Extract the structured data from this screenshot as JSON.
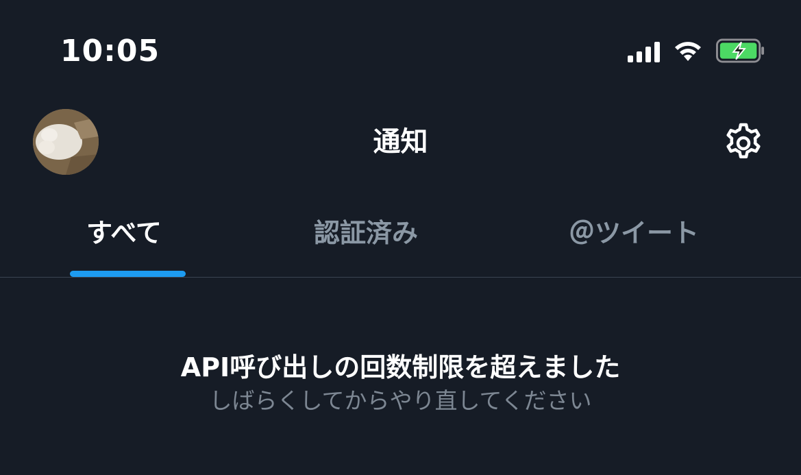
{
  "status_bar": {
    "time": "10:05",
    "icons": [
      "signal-icon",
      "wifi-icon",
      "battery-charging-icon"
    ]
  },
  "header": {
    "title": "通知",
    "avatar": "avatar",
    "settings_icon": "gear-icon"
  },
  "tabs": [
    {
      "label": "すべて",
      "active": true
    },
    {
      "label": "認証済み",
      "active": false
    },
    {
      "label": "＠ツイート",
      "active": false
    }
  ],
  "message": {
    "title": "API呼び出しの回数制限を超えました",
    "subtitle": "しばらくしてからやり直してください"
  },
  "colors": {
    "background": "#161c26",
    "accent": "#1d9bf0",
    "inactive_text": "#8b98a5",
    "battery": "#4cd964"
  }
}
